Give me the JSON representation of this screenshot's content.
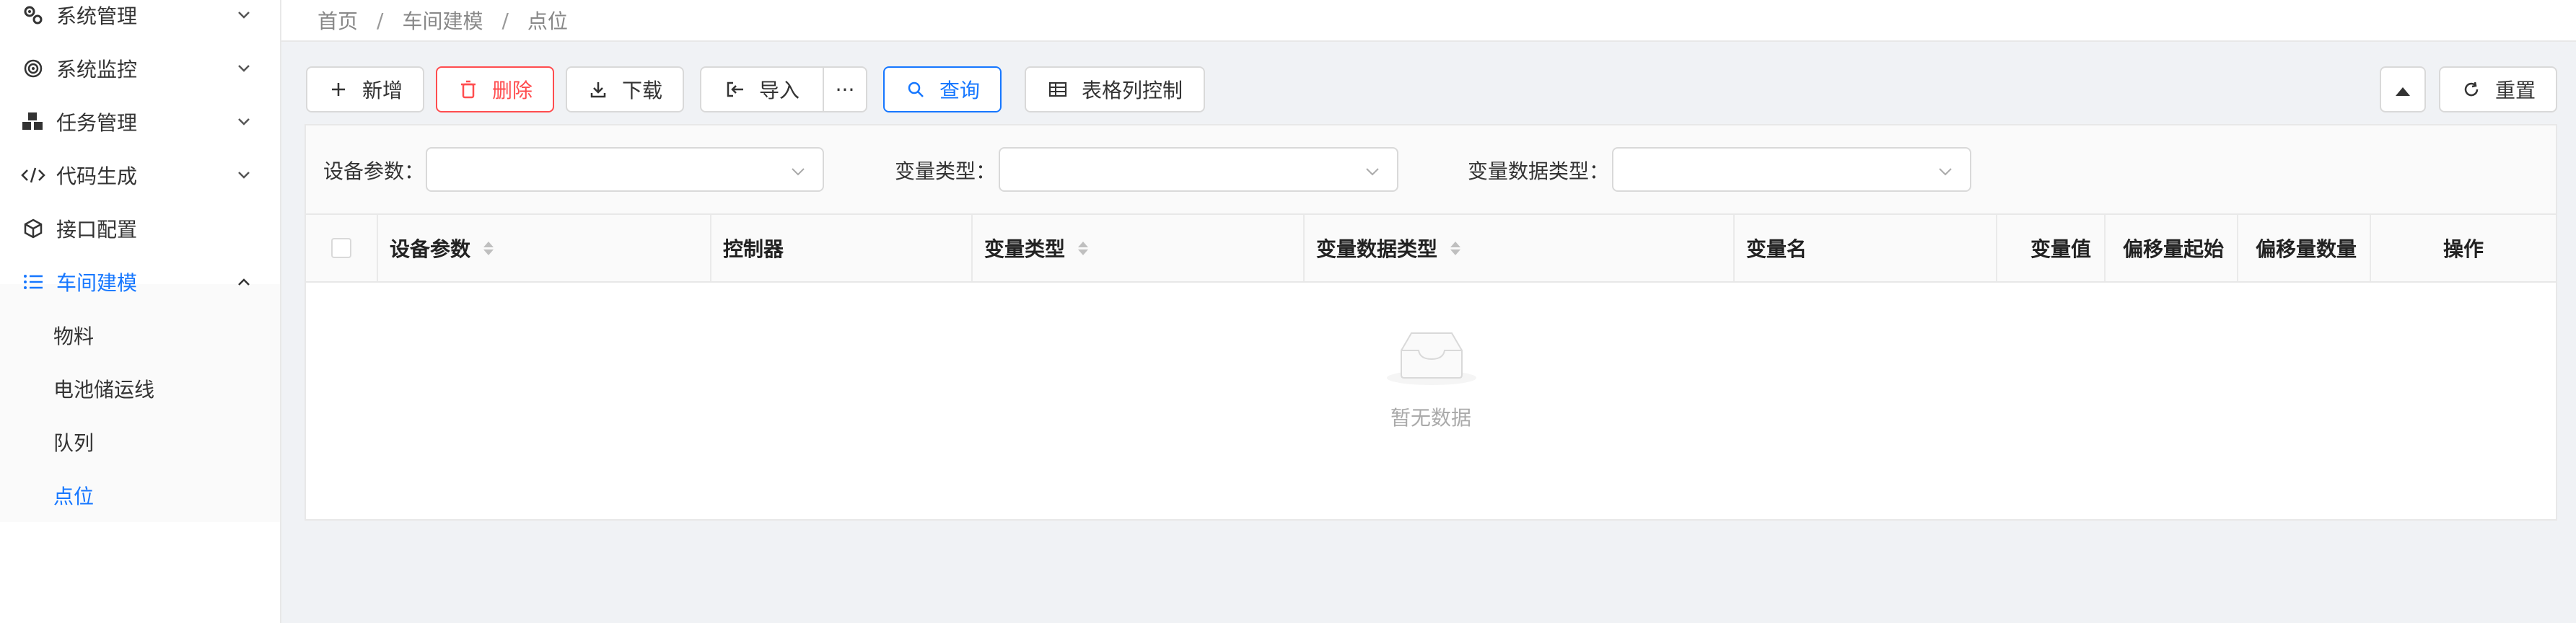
{
  "sidebar": {
    "items": [
      {
        "label": "系统管理",
        "icon": "gears-icon",
        "expanded": false
      },
      {
        "label": "系统监控",
        "icon": "monitor-target-icon",
        "expanded": false
      },
      {
        "label": "任务管理",
        "icon": "tasks-cubes-icon",
        "expanded": false
      },
      {
        "label": "代码生成",
        "icon": "code-icon",
        "expanded": false
      },
      {
        "label": "接口配置",
        "icon": "cube-icon",
        "expanded": false
      },
      {
        "label": "车间建模",
        "icon": "list-icon",
        "expanded": true,
        "active": true
      }
    ],
    "subitems": [
      {
        "label": "物料"
      },
      {
        "label": "电池储运线"
      },
      {
        "label": "队列"
      },
      {
        "label": "点位",
        "active": true
      }
    ]
  },
  "breadcrumb": {
    "items": [
      "首页",
      "车间建模",
      "点位"
    ],
    "separator": "/"
  },
  "toolbar": {
    "add_label": "新增",
    "delete_label": "删除",
    "download_label": "下载",
    "import_label": "导入",
    "more_label": "···",
    "query_label": "查询",
    "columns_label": "表格列控制",
    "reset_label": "重置"
  },
  "filters": {
    "device_param_label": "设备参数：",
    "var_type_label": "变量类型：",
    "var_data_type_label": "变量数据类型：",
    "device_param_value": "",
    "var_type_value": "",
    "var_data_type_value": ""
  },
  "table": {
    "columns": [
      "设备参数",
      "控制器",
      "变量类型",
      "变量数据类型",
      "变量名",
      "变量值",
      "偏移量起始",
      "偏移量数量",
      "操作"
    ],
    "rows": [],
    "empty_text": "暂无数据"
  },
  "colors": {
    "accent": "#1677ff",
    "danger": "#ff4d4f",
    "background": "#f0f2f5"
  }
}
